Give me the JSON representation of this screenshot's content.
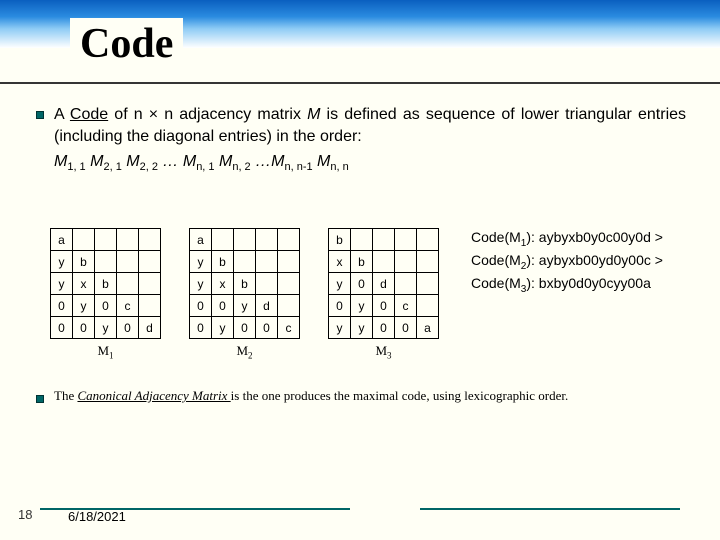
{
  "title": "Code",
  "para": "A Code of n × n adjacency matrix M is defined as sequence of lower triangular entries (including the diagonal entries) in the order:",
  "underlined_keyword": "Code",
  "sequence_parts": [
    "M",
    "1, 1",
    " M",
    "2, 1",
    " M",
    "2, 2",
    " … M",
    "n, 1",
    " M",
    "n, 2",
    " …M",
    "n, n-1",
    " M",
    "n, n"
  ],
  "matrices": [
    {
      "label_prefix": "M",
      "label_sub": "1",
      "rows": [
        [
          "a",
          "",
          "",
          "",
          ""
        ],
        [
          "y",
          "b",
          "",
          "",
          ""
        ],
        [
          "y",
          "x",
          "b",
          "",
          ""
        ],
        [
          "0",
          "y",
          "0",
          "c",
          ""
        ],
        [
          "0",
          "0",
          "y",
          "0",
          "d"
        ]
      ]
    },
    {
      "label_prefix": "M",
      "label_sub": "2",
      "rows": [
        [
          "a",
          "",
          "",
          "",
          ""
        ],
        [
          "y",
          "b",
          "",
          "",
          ""
        ],
        [
          "y",
          "x",
          "b",
          "",
          ""
        ],
        [
          "0",
          "0",
          "y",
          "d",
          ""
        ],
        [
          "0",
          "y",
          "0",
          "0",
          "c"
        ]
      ]
    },
    {
      "label_prefix": "M",
      "label_sub": "3",
      "rows": [
        [
          "b",
          "",
          "",
          "",
          ""
        ],
        [
          "x",
          "b",
          "",
          "",
          ""
        ],
        [
          "y",
          "0",
          "d",
          "",
          ""
        ],
        [
          "0",
          "y",
          "0",
          "c",
          ""
        ],
        [
          "y",
          "y",
          "0",
          "0",
          "a"
        ]
      ]
    }
  ],
  "codes": [
    {
      "prefix": "Code(M",
      "sub": "1",
      "suffix": "): aybyxb0y0c00y0d >"
    },
    {
      "prefix": "Code(M",
      "sub": "2",
      "suffix": "): aybyxb00yd0y00c >"
    },
    {
      "prefix": "Code(M",
      "sub": "3",
      "suffix": "): bxby0d0y0cyy00a"
    }
  ],
  "note_pre": "The ",
  "note_under": "Canonical Adjacency Matrix ",
  "note_post": "is the one produces the maximal code, using lexicographic order.",
  "page": "18",
  "date": "6/18/2021"
}
